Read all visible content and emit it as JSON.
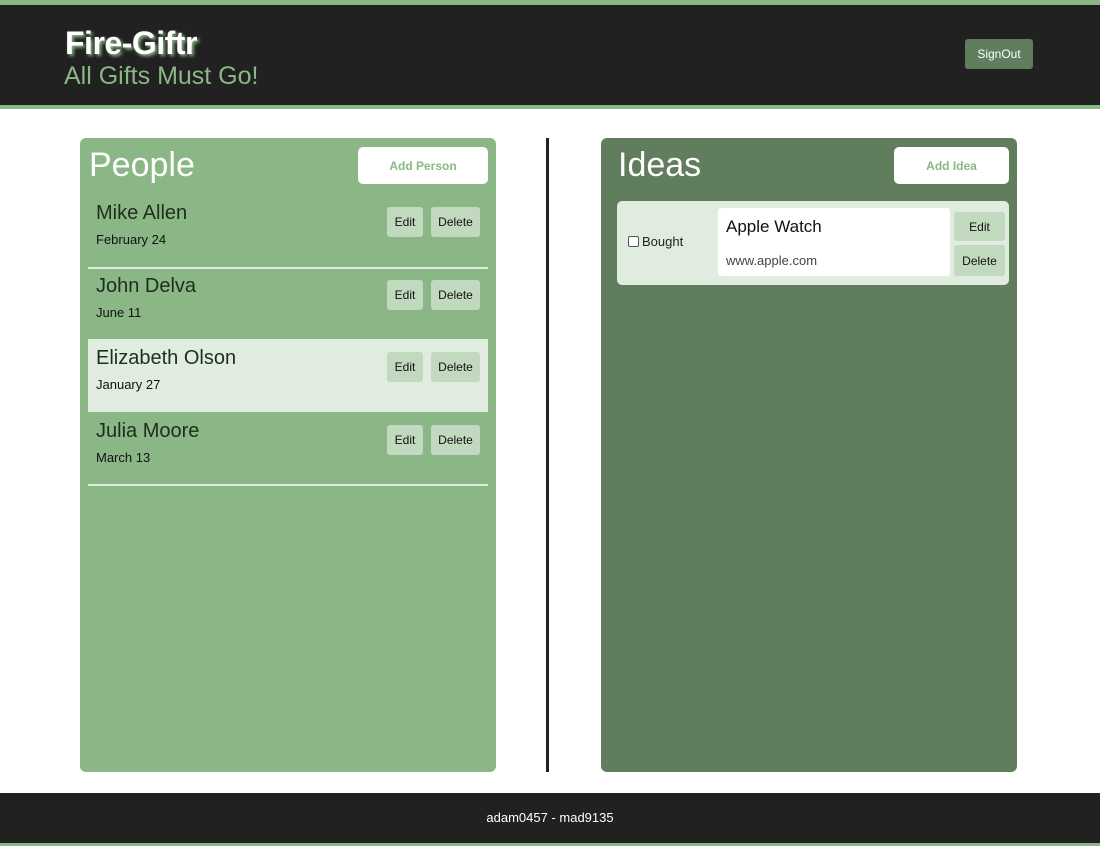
{
  "header": {
    "title": "Fire-Giftr",
    "subtitle": "All Gifts Must Go!",
    "signout_label": "SignOut"
  },
  "people": {
    "title": "People",
    "add_label": "Add Person",
    "items": [
      {
        "name": "Mike Allen",
        "date": "February 24",
        "edit_label": "Edit",
        "delete_label": "Delete",
        "selected": false
      },
      {
        "name": "John Delva",
        "date": "June 11",
        "edit_label": "Edit",
        "delete_label": "Delete",
        "selected": false
      },
      {
        "name": "Elizabeth Olson",
        "date": "January 27",
        "edit_label": "Edit",
        "delete_label": "Delete",
        "selected": true
      },
      {
        "name": "Julia Moore",
        "date": "March 13",
        "edit_label": "Edit",
        "delete_label": "Delete",
        "selected": false
      }
    ]
  },
  "ideas": {
    "title": "Ideas",
    "add_label": "Add Idea",
    "items": [
      {
        "bought_label": "Bought",
        "bought": false,
        "title": "Apple Watch",
        "url": "www.apple.com",
        "edit_label": "Edit",
        "delete_label": "Delete"
      }
    ]
  },
  "footer": {
    "text": "adam0457 - mad9135"
  },
  "colors": {
    "accent_green": "#8ab785",
    "dark_green": "#607d5d",
    "light_green": "#e0ecdf",
    "button_green": "#c1d9bf",
    "header_bg": "#212121"
  }
}
